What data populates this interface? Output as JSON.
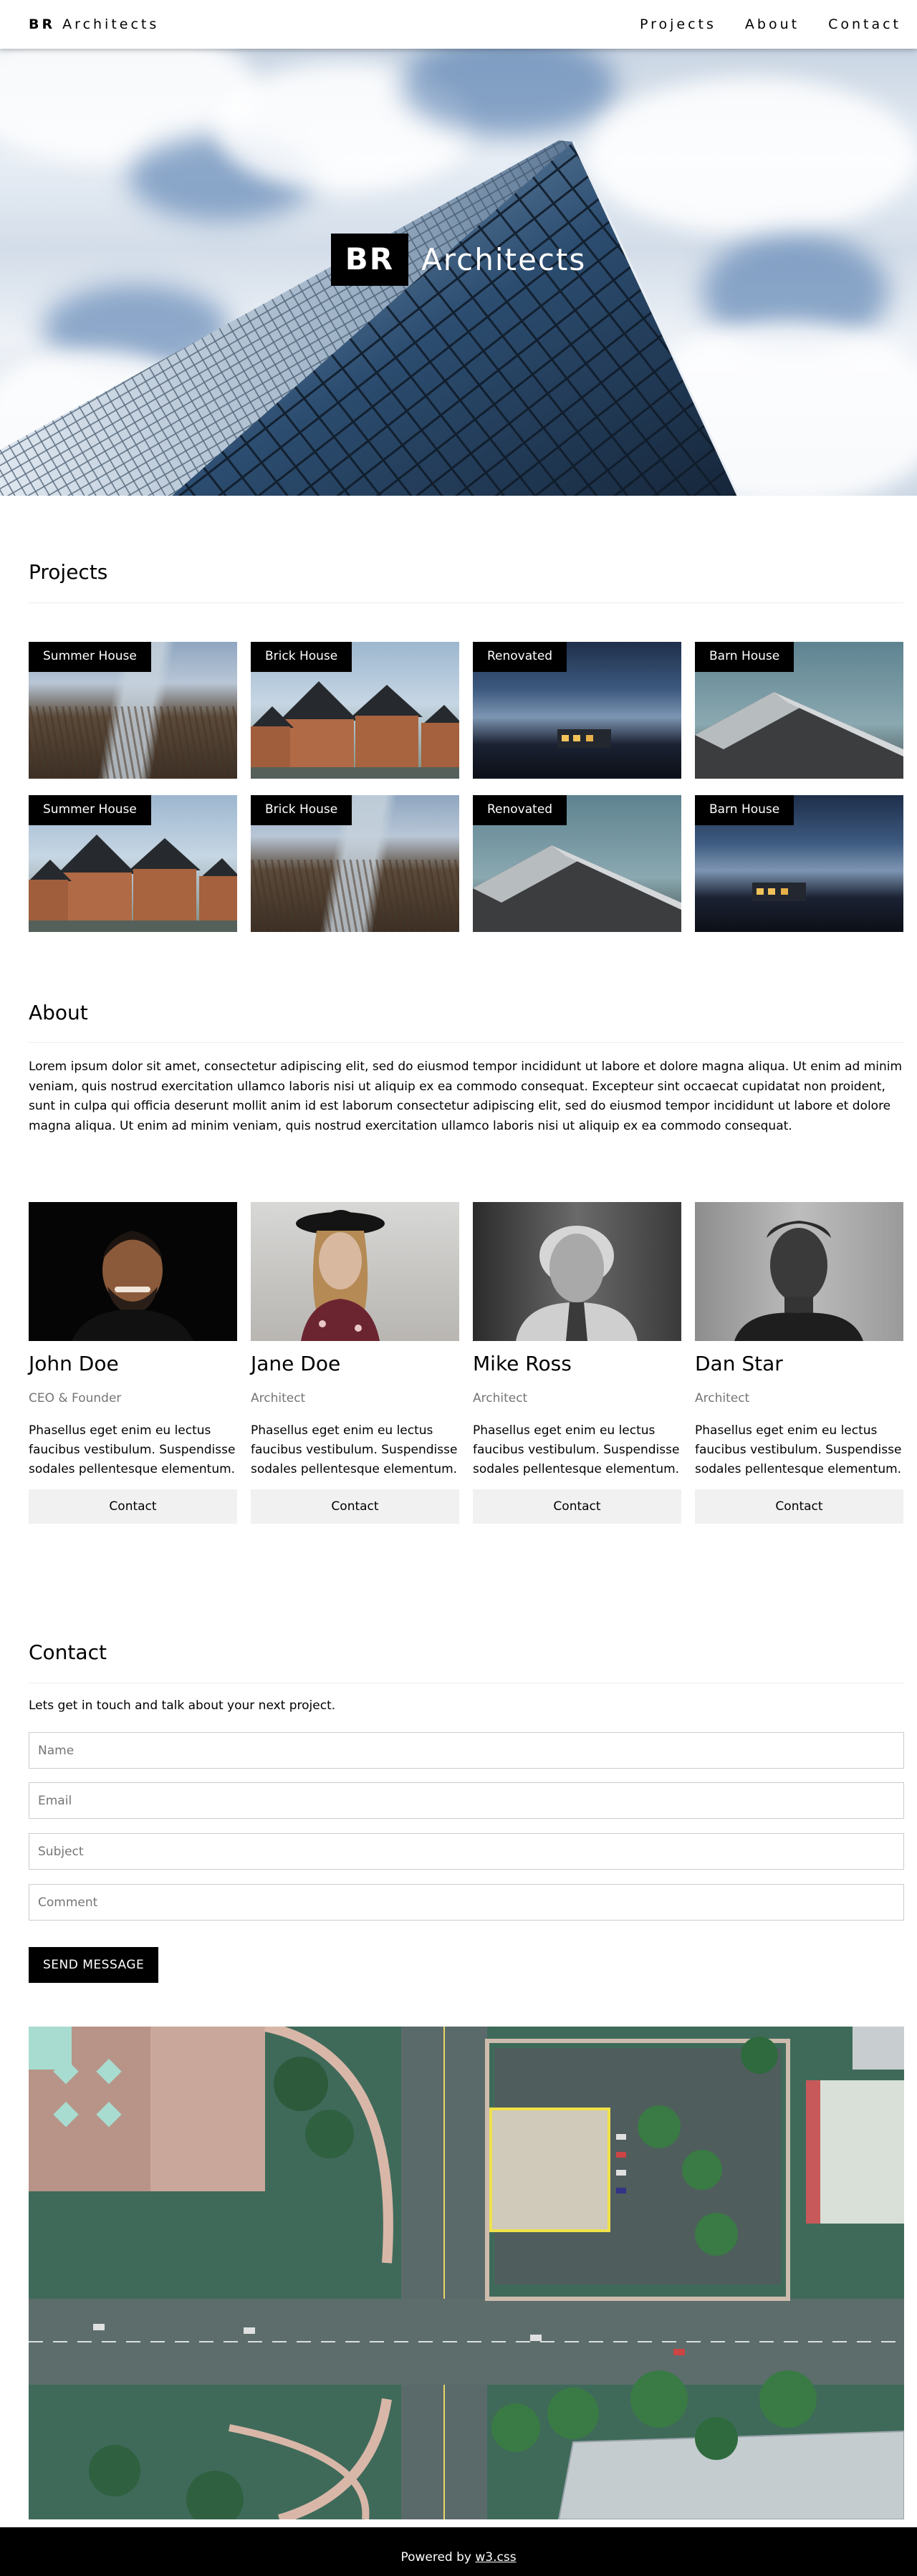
{
  "navbar": {
    "brand_bold": "BR",
    "brand_rest": "Architects",
    "links": [
      "Projects",
      "About",
      "Contact"
    ]
  },
  "hero": {
    "title_box": "BR",
    "title_rest": "Architects"
  },
  "projects": {
    "title": "Projects",
    "items": [
      {
        "label": "Summer House"
      },
      {
        "label": "Brick House"
      },
      {
        "label": "Renovated"
      },
      {
        "label": "Barn House"
      },
      {
        "label": "Summer House"
      },
      {
        "label": "Brick House"
      },
      {
        "label": "Renovated"
      },
      {
        "label": "Barn House"
      }
    ]
  },
  "about": {
    "title": "About",
    "text": "Lorem ipsum dolor sit amet, consectetur adipiscing elit, sed do eiusmod tempor incididunt ut labore et dolore magna aliqua. Ut enim ad minim veniam, quis nostrud exercitation ullamco laboris nisi ut aliquip ex ea commodo consequat. Excepteur sint occaecat cupidatat non proident, sunt in culpa qui officia deserunt mollit anim id est laborum consectetur adipiscing elit, sed do eiusmod tempor incididunt ut labore et dolore magna aliqua. Ut enim ad minim veniam, quis nostrud exercitation ullamco laboris nisi ut aliquip ex ea commodo consequat.",
    "team": [
      {
        "name": "John Doe",
        "role": "CEO & Founder",
        "desc": "Phasellus eget enim eu lectus faucibus vestibulum. Suspendisse sodales pellentesque elementum.",
        "button": "Contact"
      },
      {
        "name": "Jane Doe",
        "role": "Architect",
        "desc": "Phasellus eget enim eu lectus faucibus vestibulum. Suspendisse sodales pellentesque elementum.",
        "button": "Contact"
      },
      {
        "name": "Mike Ross",
        "role": "Architect",
        "desc": "Phasellus eget enim eu lectus faucibus vestibulum. Suspendisse sodales pellentesque elementum.",
        "button": "Contact"
      },
      {
        "name": "Dan Star",
        "role": "Architect",
        "desc": "Phasellus eget enim eu lectus faucibus vestibulum. Suspendisse sodales pellentesque elementum.",
        "button": "Contact"
      }
    ]
  },
  "contact": {
    "title": "Contact",
    "intro": "Lets get in touch and talk about your next project.",
    "fields": {
      "name": {
        "placeholder": "Name",
        "value": ""
      },
      "email": {
        "placeholder": "Email",
        "value": ""
      },
      "subject": {
        "placeholder": "Subject",
        "value": ""
      },
      "comment": {
        "placeholder": "Comment",
        "value": ""
      }
    },
    "send_label": "SEND MESSAGE"
  },
  "footer": {
    "prefix": "Powered by",
    "link": "w3.css"
  },
  "colors": {
    "nav_bg": "#ffffff",
    "text": "#000000",
    "muted": "#757575",
    "button_light": "#f1f1f1",
    "footer_bg": "#000000"
  }
}
